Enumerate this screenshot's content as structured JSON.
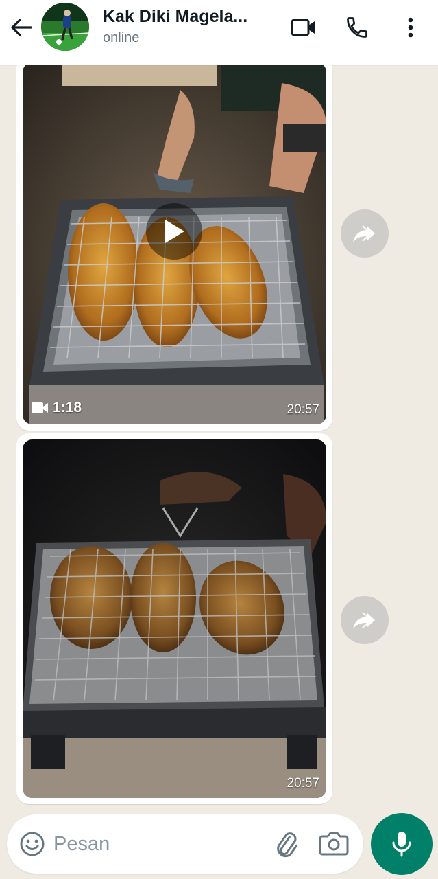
{
  "header": {
    "contact_name": "Kak Diki Magela...",
    "status": "online",
    "icons": {
      "back": "arrow-left-icon",
      "video": "video-camera-icon",
      "call": "phone-icon",
      "more": "more-vertical-icon"
    }
  },
  "messages": [
    {
      "type": "video",
      "duration": "1:18",
      "time": "20:57",
      "icons": [
        "play-icon",
        "video-camera-icon",
        "forward-icon"
      ]
    },
    {
      "type": "image",
      "time": "20:57",
      "icons": [
        "forward-icon"
      ]
    }
  ],
  "composer": {
    "placeholder": "Pesan",
    "icons": [
      "emoji-icon",
      "paperclip-icon",
      "camera-icon",
      "microphone-icon"
    ]
  },
  "colors": {
    "accent": "#008069",
    "chat_background": "#efeae2",
    "header_background": "#ffffff"
  }
}
